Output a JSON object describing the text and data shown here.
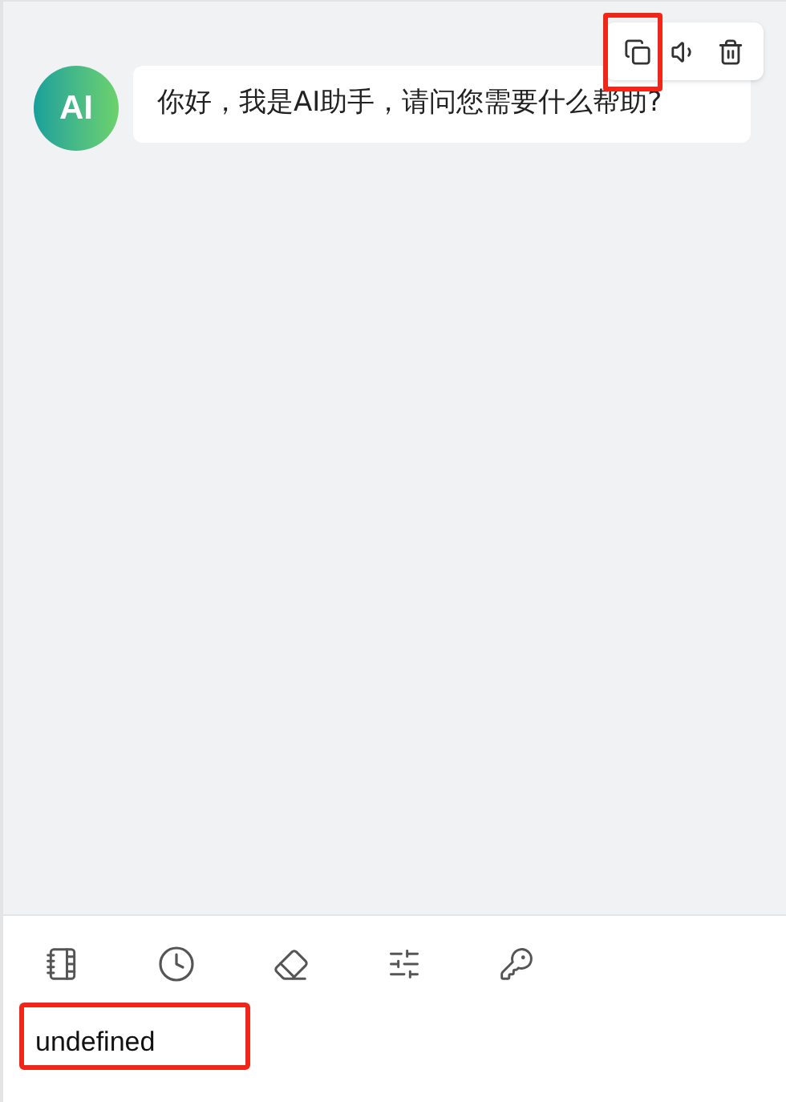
{
  "messages": [
    {
      "avatar": "AI",
      "text": "你好，我是AI助手，请问您需要什么帮助?"
    }
  ],
  "toolbar": {
    "input_text": "undefined"
  }
}
